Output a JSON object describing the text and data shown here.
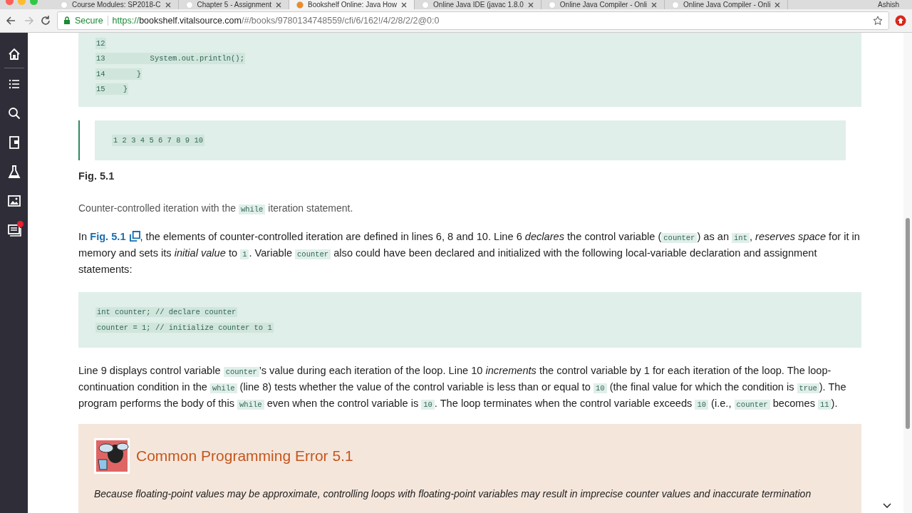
{
  "browser": {
    "tabs": [
      {
        "title": "Course Modules: SP2018-C",
        "selected": false
      },
      {
        "title": "Chapter 5 - Assignment",
        "selected": false
      },
      {
        "title": "Bookshelf Online: Java How",
        "selected": true
      },
      {
        "title": "Online Java IDE (javac 1.8.0",
        "selected": false
      },
      {
        "title": "Online Java Compiler - Onli",
        "selected": false
      },
      {
        "title": "Online Java Compiler - Onli",
        "selected": false
      }
    ],
    "profile": "Ashish",
    "url": {
      "secure_label": "Secure",
      "scheme": "https://",
      "host": "bookshelf.vitalsource.com",
      "path": "/#/books/9780134748559/cfi/6/162!/4/2/8/2/2@0:0"
    }
  },
  "sidebar": {
    "items": [
      {
        "kind": "home",
        "notification": false
      },
      {
        "kind": "contents",
        "notification": false
      },
      {
        "kind": "search",
        "notification": false
      },
      {
        "kind": "bookmark",
        "notification": false
      },
      {
        "kind": "flask",
        "notification": false
      },
      {
        "kind": "image",
        "notification": false
      },
      {
        "kind": "cards",
        "notification": true
      }
    ]
  },
  "code_listing": {
    "lines": [
      {
        "number": "12"
      },
      {
        "number": "13",
        "code": "      System.out.println();"
      },
      {
        "number": "14",
        "code": "   }"
      },
      {
        "number": "15",
        "code": "}"
      }
    ]
  },
  "output": "1 2 3 4 5 6 7 8 9 10",
  "figure": {
    "label": "Fig. 5.1",
    "caption": [
      {
        "kind": "text",
        "text": "Counter-controlled iteration with the "
      },
      {
        "kind": "code",
        "text": "while"
      },
      {
        "kind": "text",
        "text": " iteration statement."
      }
    ]
  },
  "paragraph_1": [
    {
      "kind": "text",
      "text": "In "
    },
    {
      "kind": "link",
      "text": "Fig. 5.1"
    },
    {
      "kind": "text",
      "text": ", the elements of counter-controlled iteration are defined in lines 6, 8 and 10. Line 6 *declares* the control variable ("
    },
    {
      "kind": "code",
      "text": "counter"
    },
    {
      "kind": "text",
      "text": ") as an "
    },
    {
      "kind": "code",
      "text": "int"
    },
    {
      "kind": "text",
      "text": ", *reserves space* for it in memory and sets its *initial value* to "
    },
    {
      "kind": "code",
      "text": "1"
    },
    {
      "kind": "text",
      "text": ". Variable "
    },
    {
      "kind": "code",
      "text": "counter"
    },
    {
      "kind": "text",
      "text": " also could have been declared and initialized with the following local-variable declaration and assignment statements:"
    }
  ],
  "code_block": [
    "int counter; // declare counter",
    "counter = 1; // initialize counter to 1"
  ],
  "paragraph_2": [
    {
      "kind": "text",
      "text": "Line 9 displays control variable "
    },
    {
      "kind": "code",
      "text": "counter"
    },
    {
      "kind": "text",
      "text": "’s value during each iteration of the loop. Line 10 *increments* the control variable by 1 for each iteration of the loop. The loop-continuation condition in the "
    },
    {
      "kind": "code",
      "text": "while"
    },
    {
      "kind": "text",
      "text": " (line 8) tests whether the value of the control variable is less than or equal to "
    },
    {
      "kind": "code",
      "text": "10"
    },
    {
      "kind": "text",
      "text": " (the final value for which the condition is "
    },
    {
      "kind": "code",
      "text": "true"
    },
    {
      "kind": "text",
      "text": "). The program performs the body of this "
    },
    {
      "kind": "code",
      "text": "while"
    },
    {
      "kind": "text",
      "text": " even when the control variable is "
    },
    {
      "kind": "code",
      "text": "10"
    },
    {
      "kind": "text",
      "text": ". The loop terminates when the control variable exceeds "
    },
    {
      "kind": "code",
      "text": "10"
    },
    {
      "kind": "text",
      "text": " (i.e., "
    },
    {
      "kind": "code",
      "text": "counter"
    },
    {
      "kind": "text",
      "text": " becomes "
    },
    {
      "kind": "code",
      "text": "11"
    },
    {
      "kind": "text",
      "text": ")."
    }
  ],
  "callout": {
    "title": "Common Programming Error 5.1",
    "text": "Because floating-point values may be approximate, controlling loops with floating-point variables may result in imprecise counter values and inaccurate termination"
  }
}
